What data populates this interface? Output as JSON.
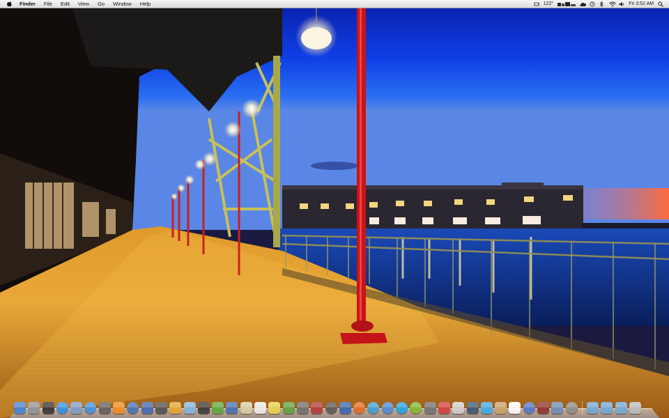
{
  "menubar": {
    "apple_icon": "apple-icon",
    "app_name": "Finder",
    "menus": [
      "File",
      "Edit",
      "View",
      "Go",
      "Window",
      "Help"
    ],
    "status": {
      "temperature": "122°",
      "clock": "Fri 3:52 AM"
    }
  },
  "dock": {
    "apps": [
      {
        "icon": "finder-icon",
        "color": "#3b7fd9"
      },
      {
        "icon": "launchpad-icon",
        "color": "#8a8f99"
      },
      {
        "icon": "dashboard-icon",
        "color": "#2b2b2b"
      },
      {
        "icon": "app-store-icon",
        "color": "#2a8ee8"
      },
      {
        "icon": "preview-icon",
        "color": "#7a99c8"
      },
      {
        "icon": "safari-icon",
        "color": "#3a8de0"
      },
      {
        "icon": "facetime-icon",
        "color": "#5a5a5a"
      },
      {
        "icon": "vlc-icon",
        "color": "#f08a1a"
      },
      {
        "icon": "quicktime-icon",
        "color": "#3c6fb8"
      },
      {
        "icon": "mission-control-icon",
        "color": "#3e63b5"
      },
      {
        "icon": "alfred-icon",
        "color": "#4b4b4b"
      },
      {
        "icon": "colloquy-icon",
        "color": "#e3a52d"
      },
      {
        "icon": "adium-icon",
        "color": "#7bb3e0"
      },
      {
        "icon": "time-machine-icon",
        "color": "#333333"
      },
      {
        "icon": "hd-photo-icon",
        "color": "#58a73a"
      },
      {
        "icon": "tv-icon",
        "color": "#3f6bb0"
      },
      {
        "icon": "notes-icon",
        "color": "#d8cfa8"
      },
      {
        "icon": "text-edit-icon",
        "color": "#eeeeee"
      },
      {
        "icon": "stickies-icon",
        "color": "#e8d44d"
      },
      {
        "icon": "evernote-icon",
        "color": "#5aa03b"
      },
      {
        "icon": "preferences-icon",
        "color": "#6a6a6a"
      },
      {
        "icon": "photo-booth-icon",
        "color": "#b03434"
      },
      {
        "icon": "camera-icon",
        "color": "#555555"
      },
      {
        "icon": "hype-icon",
        "color": "#3062b0"
      },
      {
        "icon": "firefox-icon",
        "color": "#e06a1e"
      },
      {
        "icon": "network-icon",
        "color": "#3a9ed6"
      },
      {
        "icon": "itunes-play-icon",
        "color": "#4a87d6"
      },
      {
        "icon": "skype-icon",
        "color": "#19a3e6"
      },
      {
        "icon": "spotify-icon",
        "color": "#7cb82a"
      },
      {
        "icon": "printer-icon",
        "color": "#6d6d6d"
      },
      {
        "icon": "cleaner-icon",
        "color": "#d33a3a"
      },
      {
        "icon": "coffee-icon",
        "color": "#d0d0d0"
      },
      {
        "icon": "tumblr-icon",
        "color": "#34526f"
      },
      {
        "icon": "twitter-icon",
        "color": "#3ba8e8"
      },
      {
        "icon": "address-book-icon",
        "color": "#c9a36b"
      },
      {
        "icon": "calendar-icon",
        "color": "#ffffff"
      },
      {
        "icon": "itunes-icon",
        "color": "#4a73c8"
      },
      {
        "icon": "dictionary-icon",
        "color": "#8c2a2a"
      },
      {
        "icon": "iphoto-icon",
        "color": "#6a8ab8"
      },
      {
        "icon": "system-preferences-icon",
        "color": "#8a8a8a"
      }
    ],
    "stacks": [
      {
        "icon": "applications-folder-icon",
        "color": "#6da7d8"
      },
      {
        "icon": "documents-folder-icon",
        "color": "#6da7d8"
      },
      {
        "icon": "downloads-folder-icon",
        "color": "#6da7d8"
      },
      {
        "icon": "trash-icon",
        "color": "#b9bcc2"
      }
    ]
  }
}
